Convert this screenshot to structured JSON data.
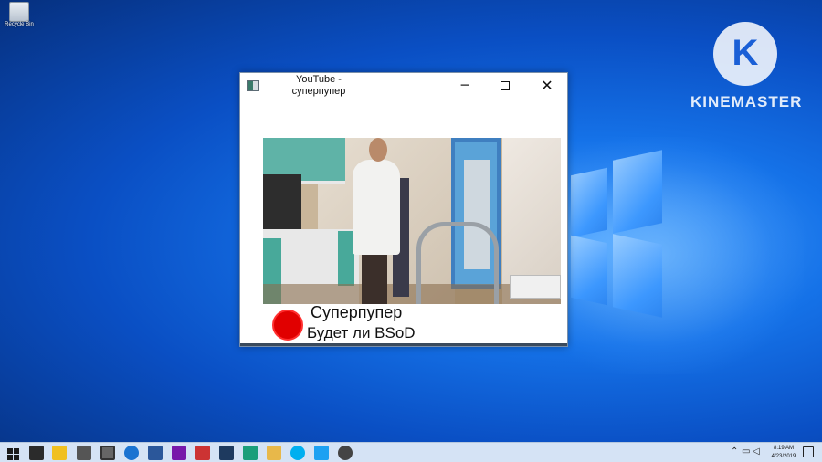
{
  "desktop": {
    "recycle_bin_label": "Recycle Bin",
    "watermark_text": "KINEMASTER",
    "watermark_logo_letter": "K"
  },
  "window": {
    "title": "YouTube - суперпупер",
    "minimize_label": "─",
    "close_label": "✕",
    "channel_name": "Суперпупер",
    "video_title": "Будет ли BSoD"
  },
  "taskbar": {
    "icons": [
      "start-icon",
      "store-icon",
      "file-explorer-icon",
      "mail-icon",
      "calendar-icon",
      "edge-icon",
      "word-icon",
      "onenote-icon",
      "photos-icon",
      "publisher-icon",
      "paint-icon",
      "skype-icon",
      "twitter-icon",
      "settings-icon"
    ],
    "time": "8:19 AM",
    "date": "4/23/2019"
  },
  "colors": {
    "accent": "#0a4fc4",
    "avatar": "#e10000",
    "taskbar": "#d5e3f5"
  }
}
